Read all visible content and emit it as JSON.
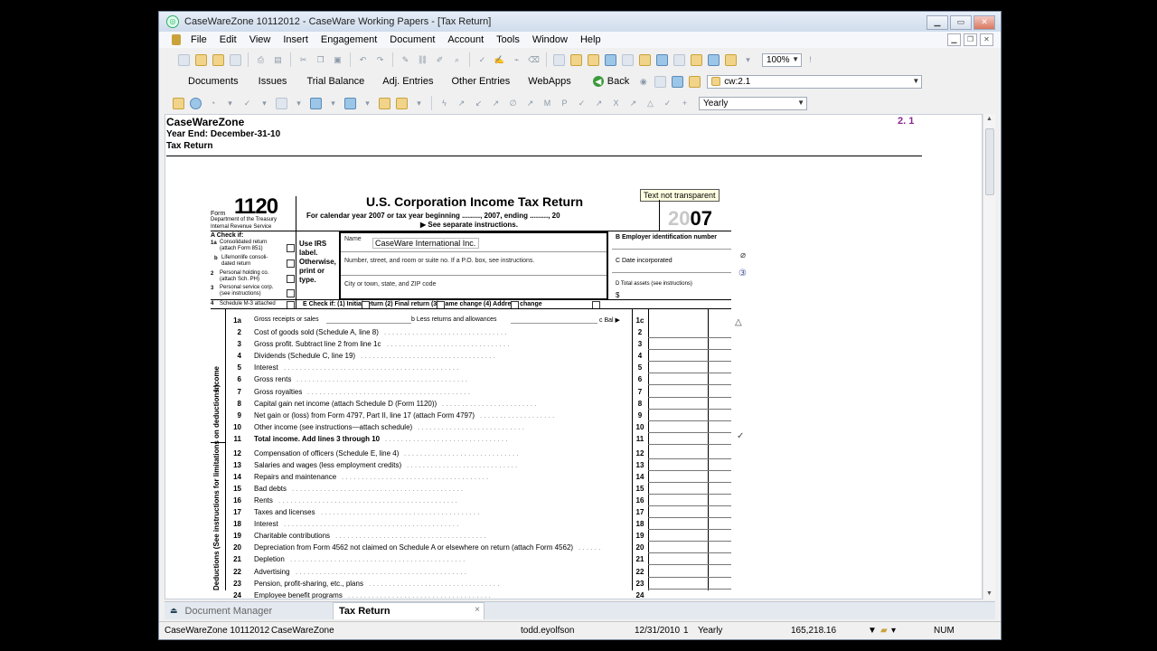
{
  "window": {
    "title": "CaseWareZone 10112012 - CaseWare Working Papers - [Tax Return]",
    "app_icon": "caseware-icon",
    "controls": [
      "minimize-icon",
      "maximize-icon",
      "close-icon"
    ]
  },
  "menu": {
    "items": [
      "File",
      "Edit",
      "View",
      "Insert",
      "Engagement",
      "Document",
      "Account",
      "Tools",
      "Window",
      "Help"
    ]
  },
  "toolbar1": {
    "zoom": "100%"
  },
  "toolbar2": {
    "nav_items": [
      "Documents",
      "Issues",
      "Trial Balance",
      "Adj. Entries",
      "Other Entries",
      "WebApps"
    ],
    "back_label": "Back",
    "location": "cw:2.1"
  },
  "toolbar3": {
    "period": "Yearly"
  },
  "document": {
    "header_company": "CaseWareZone",
    "header_yearend": "Year End: December-31-10",
    "header_doc": "Tax Return",
    "ref": "2. 1",
    "tooltip": "Text not transparent"
  },
  "form": {
    "form_word": "Form",
    "form_number": "1120",
    "dept_line1": "Department of the Treasury",
    "dept_line2": "Internal Revenue Service",
    "title": "U.S. Corporation Income Tax Return",
    "subtitle": "For calendar year 2007 or tax year beginning ........., 2007, ending ........., 20",
    "subtitle2": "▶ See separate instructions.",
    "year_light": "20",
    "year_dark": "07",
    "check_if": "A  Check if:",
    "checks": [
      {
        "num": "1a",
        "text": "Consolidated return (attach Form 851)"
      },
      {
        "num": "b",
        "text": "Life/nonlife consoli- dated return"
      },
      {
        "num": "2",
        "text": "Personal holding co. (attach Sch. PH)"
      },
      {
        "num": "3",
        "text": "Personal service corp. (see instructions)"
      },
      {
        "num": "4",
        "text": "Schedule M-3 attached"
      }
    ],
    "use_irs": "Use IRS label. Otherwise, print or type.",
    "name_label": "Name",
    "name_value": "CaseWare International Inc.",
    "street_label": "Number, street, and room or suite no. If a P.O. box, see instructions.",
    "city_label": "City or town, state, and ZIP code",
    "ein_label": "B  Employer identification number",
    "date_label": "C  Date incorporated",
    "assets_label": "D  Total assets (see instructions)",
    "assets_dollar": "$",
    "e_check": "E   Check if:   (1)      Initial return         (2)      Final return          (3)      Name change         (4)      Address change",
    "income_label": "Income",
    "deductions_label": "Deductions (See instructions for limitations on deductions.)",
    "line1a": {
      "num": "1a",
      "text": "Gross receipts or sales",
      "b_text": "b Less returns and allowances",
      "c_text": "c Bal ▶",
      "box": "1c"
    },
    "lines": [
      {
        "num": "2",
        "text": "Cost of goods sold (Schedule A, line 8)",
        "box": "2"
      },
      {
        "num": "3",
        "text": "Gross profit. Subtract line 2 from line 1c",
        "box": "3"
      },
      {
        "num": "4",
        "text": "Dividends (Schedule C, line 19)",
        "box": "4"
      },
      {
        "num": "5",
        "text": "Interest",
        "box": "5"
      },
      {
        "num": "6",
        "text": "Gross rents",
        "box": "6"
      },
      {
        "num": "7",
        "text": "Gross royalties",
        "box": "7"
      },
      {
        "num": "8",
        "text": "Capital gain net income (attach Schedule D (Form 1120))",
        "box": "8"
      },
      {
        "num": "9",
        "text": "Net gain or (loss) from Form 4797, Part II, line 17 (attach Form 4797)",
        "box": "9"
      },
      {
        "num": "10",
        "text": "Other income (see instructions—attach schedule)",
        "box": "10"
      },
      {
        "num": "11",
        "text": "Total income. Add lines 3 through 10",
        "box": "11"
      },
      {
        "num": "12",
        "text": "Compensation of officers (Schedule E, line 4)",
        "box": "12"
      },
      {
        "num": "13",
        "text": "Salaries and wages (less employment credits)",
        "box": "13"
      },
      {
        "num": "14",
        "text": "Repairs and maintenance",
        "box": "14"
      },
      {
        "num": "15",
        "text": "Bad debts",
        "box": "15"
      },
      {
        "num": "16",
        "text": "Rents",
        "box": "16"
      },
      {
        "num": "17",
        "text": "Taxes and licenses",
        "box": "17"
      },
      {
        "num": "18",
        "text": "Interest",
        "box": "18"
      },
      {
        "num": "19",
        "text": "Charitable contributions",
        "box": "19"
      },
      {
        "num": "20",
        "text": "Depreciation from Form 4562 not claimed on Schedule A or elsewhere on return (attach Form 4562)",
        "box": "20"
      },
      {
        "num": "21",
        "text": "Depletion",
        "box": "21"
      },
      {
        "num": "22",
        "text": "Advertising",
        "box": "22"
      },
      {
        "num": "23",
        "text": "Pension, profit-sharing, etc., plans",
        "box": "23"
      },
      {
        "num": "24",
        "text": "Employee benefit programs",
        "box": "24"
      }
    ]
  },
  "tabs": {
    "doc_manager": "Document Manager",
    "active_tab": "Tax Return",
    "close": "×"
  },
  "status": {
    "engagement": "CaseWareZone 10112012",
    "entity": "CaseWareZone",
    "user": "todd.eyolfson",
    "date": "12/31/2010",
    "period_num": "1",
    "period": "Yearly",
    "value": "165,218.16",
    "num": "NUM"
  }
}
